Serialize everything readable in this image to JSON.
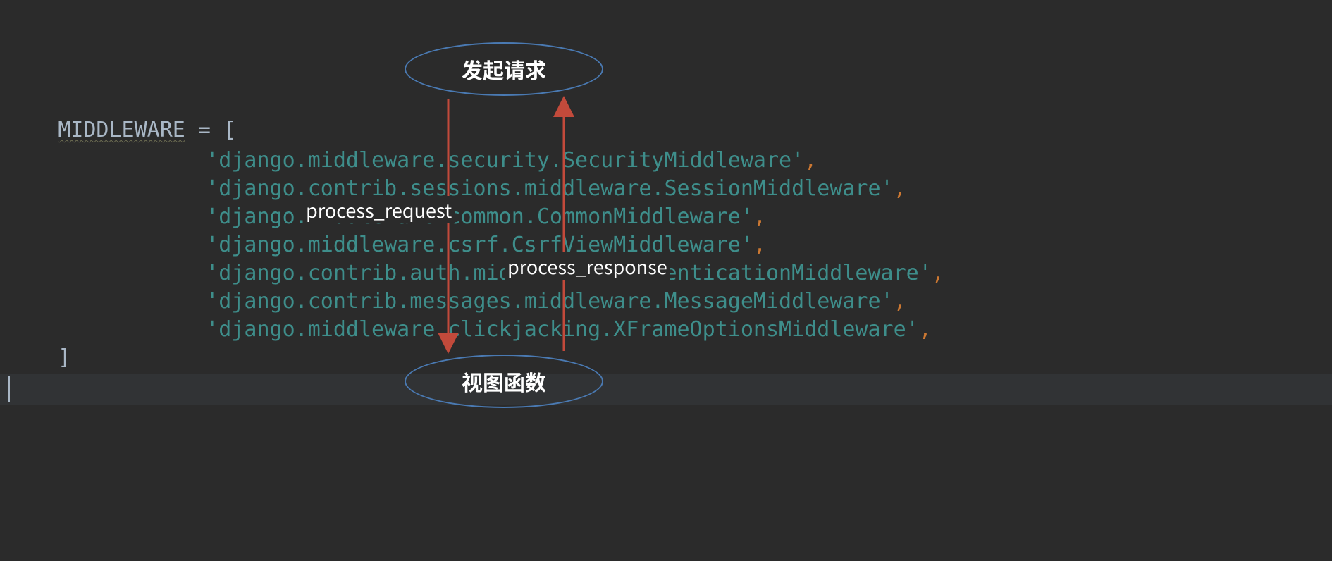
{
  "code": {
    "declaration_name": "MIDDLEWARE",
    "declaration_rest": " = [",
    "open_bracket_underlined": true,
    "strings": [
      "'django.middleware.security.SecurityMiddleware'",
      "'django.contrib.sessions.middleware.SessionMiddleware'",
      "'django.middleware.common.CommonMiddleware'",
      "'django.middleware.csrf.CsrfViewMiddleware'",
      "'django.contrib.auth.middleware.AuthenticationMiddleware'",
      "'django.contrib.messages.middleware.MessageMiddleware'",
      "'django.middleware.clickjacking.XFrameOptionsMiddleware'"
    ],
    "comma": ",",
    "close_bracket": "]"
  },
  "nodes": {
    "top": "发起请求",
    "bottom": "视图函数"
  },
  "labels": {
    "request": "process_request",
    "response": "process_response"
  },
  "colors": {
    "bg": "#2b2b2b",
    "string": "#3e8e8b",
    "punct": "#cc7832",
    "ellipse_border": "#4a7ab3",
    "arrow": "#c24a3b"
  }
}
